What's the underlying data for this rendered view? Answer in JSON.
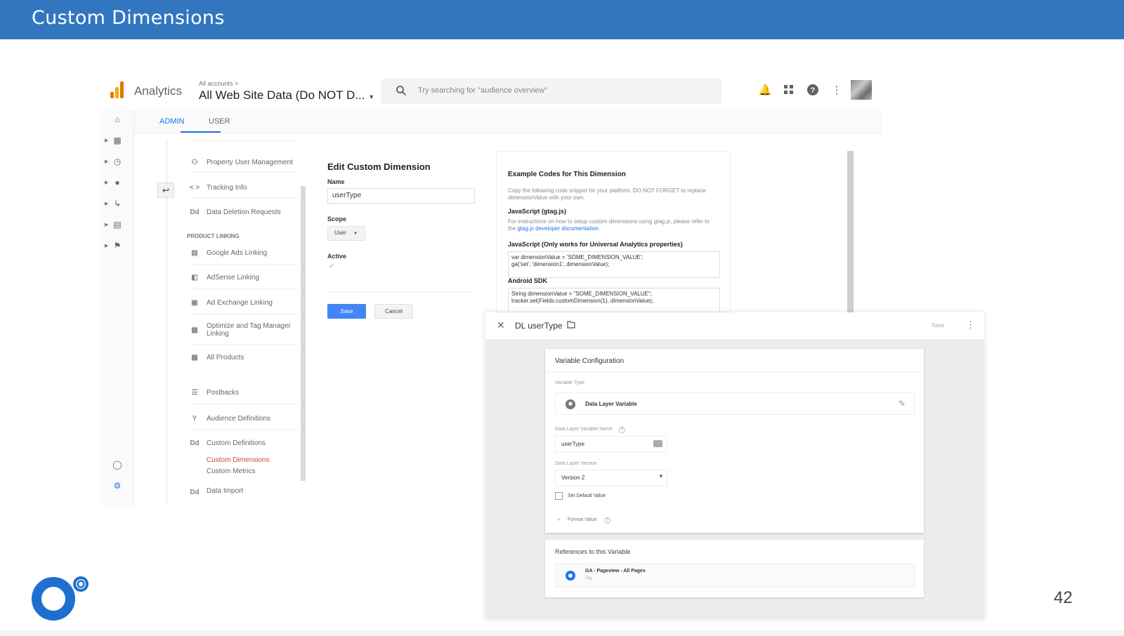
{
  "slide": {
    "title": "Custom Dimensions",
    "page_number": "42",
    "colors": {
      "header": "#3376c0",
      "accent": "#1a73e8"
    }
  },
  "ga": {
    "brand": "Analytics",
    "breadcrumb": "All accounts >",
    "property": "All Web Site Data (Do NOT D...",
    "search_placeholder": "Try searching for \"audience overview\"",
    "top_icons": [
      "bell-icon",
      "apps-grid-icon",
      "help-icon",
      "more-vert-icon"
    ],
    "tabs": {
      "admin": "ADMIN",
      "user": "USER"
    },
    "property_menu": {
      "items": [
        {
          "icon": "people-icon",
          "label": "Property User Management"
        },
        {
          "icon": "code-icon",
          "label": "Tracking Info"
        },
        {
          "icon": "dd-icon",
          "label": "Data Deletion Requests"
        }
      ],
      "section_heading": "PRODUCT LINKING",
      "linking_items": [
        {
          "icon": "ads-icon",
          "label": "Google Ads Linking"
        },
        {
          "icon": "adsense-icon",
          "label": "AdSense Linking"
        },
        {
          "icon": "adexchange-icon",
          "label": "Ad Exchange Linking"
        },
        {
          "icon": "optimize-icon",
          "label": "Optimize and Tag Manager Linking"
        },
        {
          "icon": "products-icon",
          "label": "All Products"
        }
      ],
      "other_items": [
        {
          "icon": "postbacks-icon",
          "label": "Postbacks"
        },
        {
          "icon": "audience-icon",
          "label": "Audience Definitions"
        },
        {
          "icon": "dd-icon",
          "label": "Custom Definitions"
        },
        {
          "icon": "dd-icon",
          "label": "Data Import"
        }
      ],
      "sub_links": {
        "active": "Custom Dimensions",
        "other": "Custom Metrics"
      }
    },
    "edit_form": {
      "title": "Edit Custom Dimension",
      "name_label": "Name",
      "name_value": "userType",
      "scope_label": "Scope",
      "scope_value": "User",
      "active_label": "Active",
      "active_checked": true,
      "save_label": "Save",
      "cancel_label": "Cancel"
    },
    "codes": {
      "title": "Example Codes for This Dimension",
      "intro": "Copy the following code snippet for your platform. DO NOT FORGET to replace dimensionValue with your own.",
      "gtag_heading": "JavaScript (gtag.js)",
      "gtag_text_before": "For instructions on how to setup custom dimensions using gtag.js, please refer to the",
      "gtag_link": "gtag.js developer documentation",
      "gtag_text_after": ".",
      "ua_heading": "JavaScript (Only works for Universal Analytics properties)",
      "ua_code_line1": "var dimensionValue = 'SOME_DIMENSION_VALUE';",
      "ua_code_line2": "ga('set', 'dimension1', dimensionValue);",
      "android_heading": "Android SDK",
      "android_code_line1": "String dimensionValue = \"SOME_DIMENSION_VALUE\";",
      "android_code_line2": "tracker.set(Fields.customDimension(1), dimensionValue);"
    }
  },
  "gtm": {
    "variable_name": "DL userType",
    "save_label": "Save",
    "config": {
      "title": "Variable Configuration",
      "type_label": "Variable Type",
      "type_value": "Data Layer Variable",
      "dl_name_label": "Data Layer Variable Name",
      "dl_name_value": "userType",
      "version_label": "Data Layer Version",
      "version_value": "Version 2",
      "default_label": "Set Default Value",
      "default_checked": false,
      "format_label": "Format Value"
    },
    "references": {
      "title": "References to this Variable",
      "tag_name": "GA - Pageview - All Pages",
      "tag_type": "Tag"
    }
  }
}
